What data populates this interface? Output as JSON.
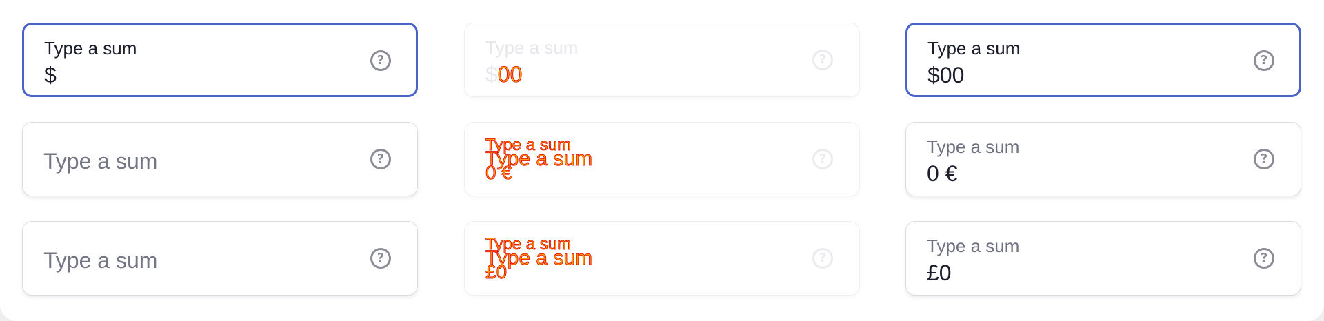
{
  "columns": [
    {
      "fields": [
        {
          "state": "focused",
          "label": "Type a sum",
          "value": "$"
        },
        {
          "state": "empty",
          "placeholder": "Type a sum"
        },
        {
          "state": "empty",
          "placeholder": "Type a sum"
        }
      ]
    },
    {
      "fields": [
        {
          "state": "disabled",
          "label": "Type a sum",
          "value_prefix": "$",
          "value_overlay": "00"
        },
        {
          "state": "disabled",
          "label": "Type a sum",
          "overlay_label": "Type a sum",
          "value": "0 €"
        },
        {
          "state": "disabled",
          "label": "Type a sum",
          "overlay_label": "Type a sum",
          "value": "£0"
        }
      ]
    },
    {
      "fields": [
        {
          "state": "focused",
          "label": "Type a sum",
          "value": "$00"
        },
        {
          "state": "filled",
          "label": "Type a sum",
          "value": "0 €"
        },
        {
          "state": "filled",
          "label": "Type a sum",
          "value": "£0"
        }
      ]
    }
  ],
  "help_icon": {
    "name": "question-circle-icon",
    "glyph": "?"
  },
  "colors": {
    "focus_border": "#4a63c9",
    "text": "#1d1d2b",
    "placeholder": "#737585",
    "icon": "#8a8c96",
    "glitch_fill": "#ff9a00",
    "glitch_stroke": "#e00000"
  }
}
